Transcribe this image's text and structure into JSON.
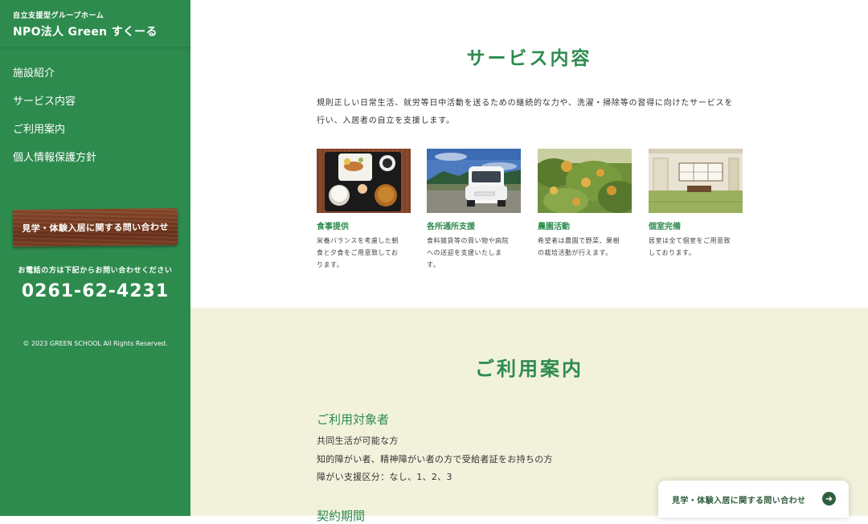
{
  "sidebar": {
    "subtitle": "自立支援型グループホーム",
    "title": "NPO法人 Green すくーる",
    "nav": [
      "施設紹介",
      "サービス内容",
      "ご利用案内",
      "個人情報保護方針"
    ],
    "contact_button": "見学・体験入居に関する問い合わせ",
    "phone_note": "お電話の方は下記からお問い合わせください",
    "phone": "0261-62-4231",
    "copyright": "© 2023 GREEN SCHOOL All Rights Reserved."
  },
  "services": {
    "title": "サービス内容",
    "intro_line1": "規則正しい日常生活、就労等日中活動を送るための継続的な力や、洗濯・掃除等の習得に向けたサービスを",
    "intro_line2": "行い、入居者の自立を支援します。",
    "cards": [
      {
        "title": "食事提供",
        "desc1": "栄養バランスを考慮した朝",
        "desc2": "食と夕食をご用意致してお",
        "desc3": "ります。",
        "image": "meal-photo"
      },
      {
        "title": "各所通所支援",
        "desc1": "食料雑貨等の買い物や病院",
        "desc2": "への送迎を支援いたしま",
        "desc3": "す。",
        "image": "car-photo"
      },
      {
        "title": "農園活動",
        "desc1": "希望者は農園で野菜、果樹",
        "desc2": "の栽培活動が行えます。",
        "desc3": "",
        "image": "orchard-photo"
      },
      {
        "title": "個室完備",
        "desc1": "居室は全て個室をご用意致",
        "desc2": "しております。",
        "desc3": "",
        "image": "room-photo"
      }
    ]
  },
  "guide": {
    "title": "ご利用案内",
    "target_heading": "ご利用対象者",
    "target_lines": [
      "共同生活が可能な方",
      "知的障がい者、精神障がい者の方で受給者証をお持ちの方",
      "障がい支援区分：なし、1、2、3"
    ],
    "next_heading": "契約期間"
  },
  "floating_contact": {
    "label": "見学・体験入居に関する問い合わせ",
    "icon": "arrow-right-icon"
  },
  "colors": {
    "brand_green": "#2e8b4e",
    "guide_bg": "#f2f2dc",
    "wood": "#7a3d22"
  }
}
